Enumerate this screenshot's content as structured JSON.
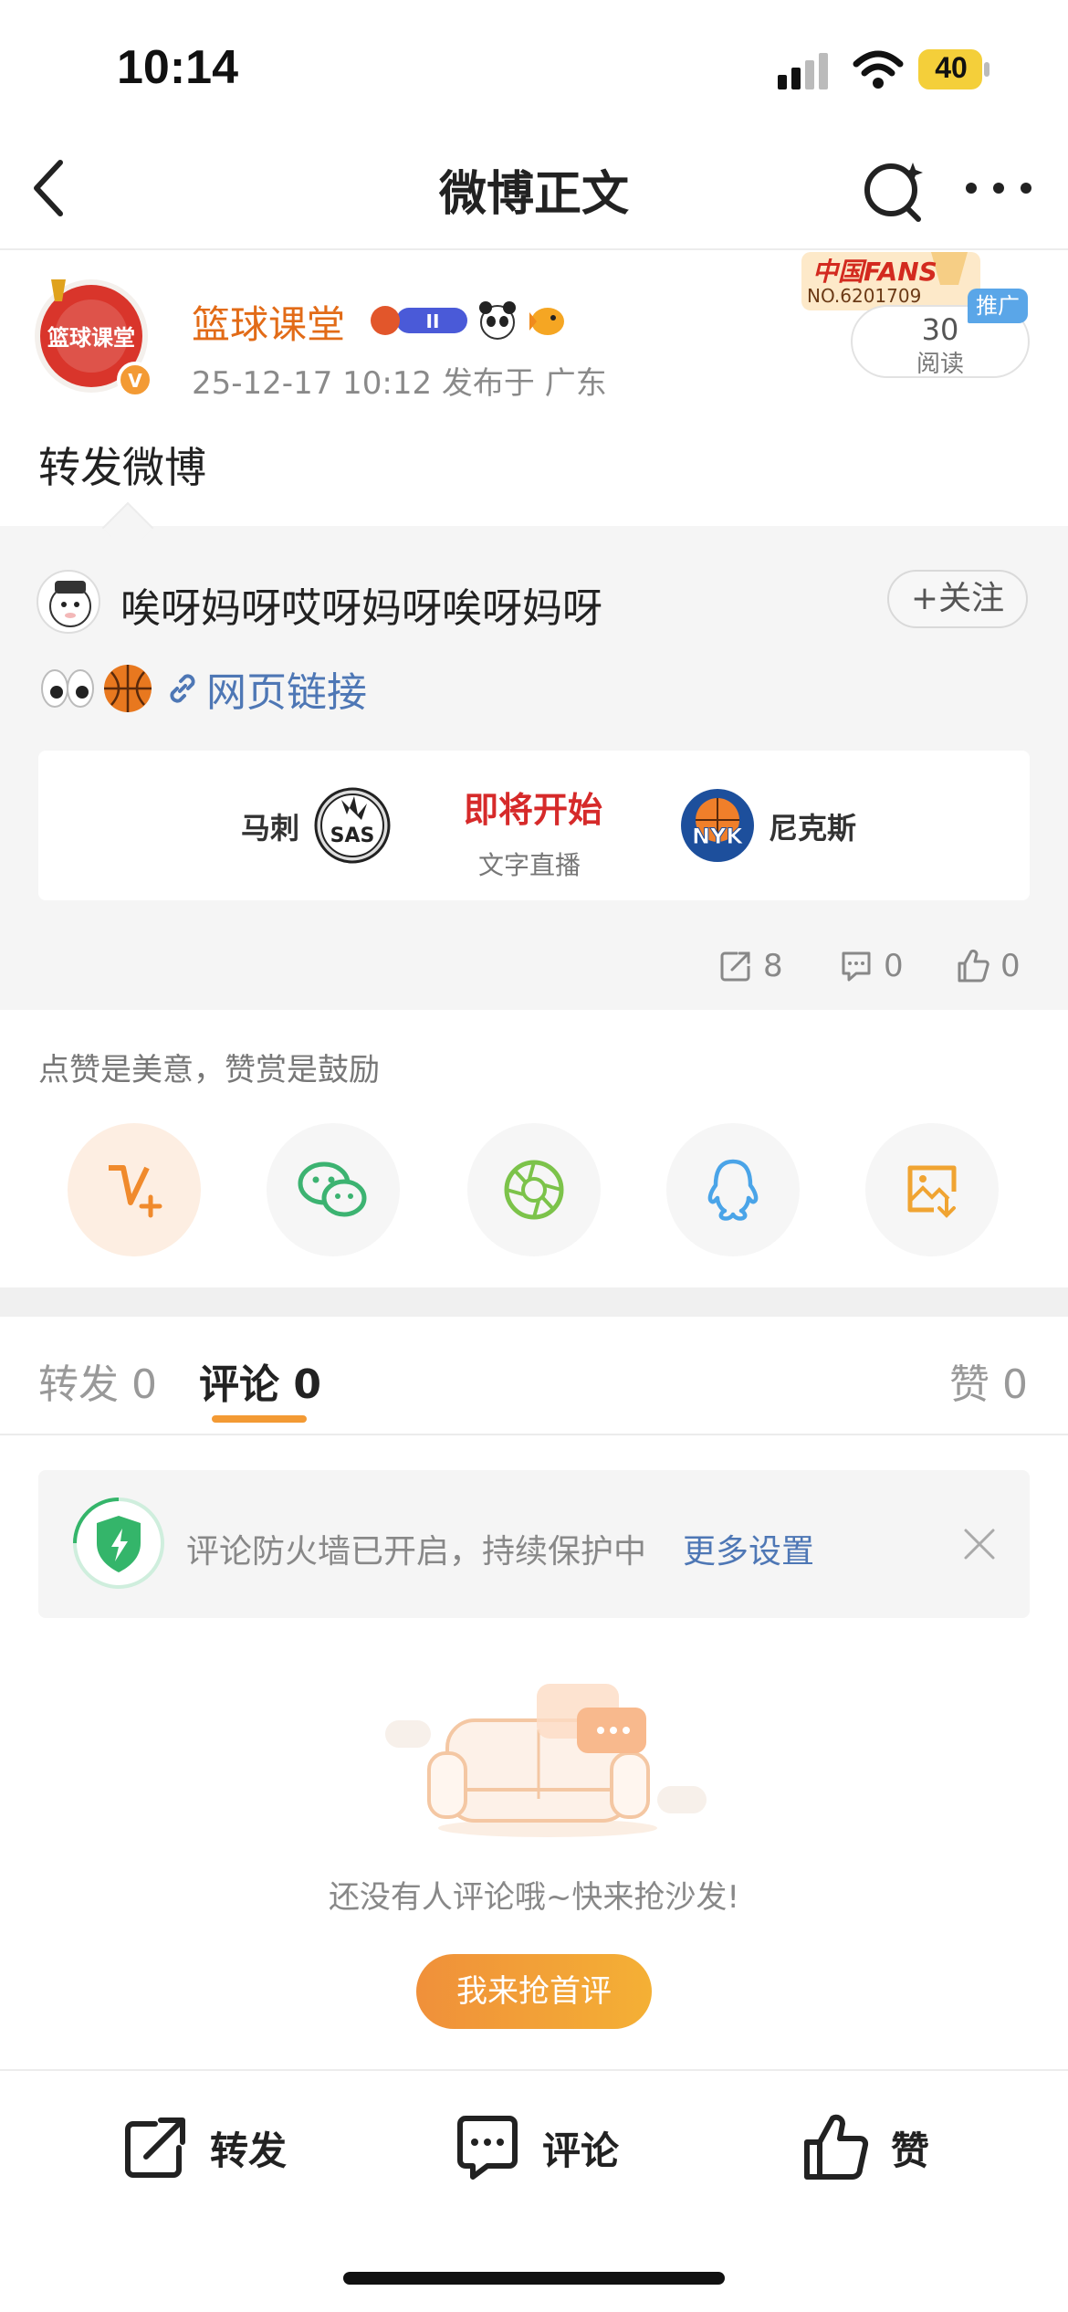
{
  "status_bar": {
    "time": "10:14",
    "battery": "40"
  },
  "nav": {
    "title": "微博正文"
  },
  "author": {
    "name": "篮球课堂",
    "meta": "25-12-17 10:12  发布于 广东",
    "fans_badge_line1": "中国FANS",
    "fans_badge_line2": "NO.6201709",
    "read_count": "30",
    "read_label": "阅读",
    "promo_tag": "推广"
  },
  "post": {
    "text": "转发微博"
  },
  "retweet": {
    "user_name": "唉呀妈呀哎呀妈呀唉呀妈呀",
    "follow_label": "+关注",
    "link_text": "网页链接",
    "match": {
      "team_left": "马刺",
      "team_left_logo": "SAS",
      "status": "即将开始",
      "sub": "文字直播",
      "team_right": "尼克斯",
      "team_right_logo": "NYK"
    },
    "stats": {
      "reposts": "8",
      "comments": "0",
      "likes": "0"
    }
  },
  "reward": {
    "text": "点赞是美意，赞赏是鼓励",
    "share_icons": [
      "vplus-icon",
      "wechat-icon",
      "moments-icon",
      "qq-icon",
      "save-image-icon"
    ]
  },
  "tabs": [
    {
      "label": "转发",
      "count": "0"
    },
    {
      "label": "评论",
      "count": "0"
    },
    {
      "label": "赞",
      "count": "0"
    }
  ],
  "firewall": {
    "text": "评论防火墙已开启，持续保护中",
    "link": "更多设置"
  },
  "empty": {
    "text": "还没有人评论哦~快来抢沙发!",
    "button": "我来抢首评"
  },
  "bottom_bar": {
    "repost": "转发",
    "comment": "评论",
    "like": "赞"
  },
  "colors": {
    "accent_orange": "#f39a34",
    "link_blue": "#4e77b5",
    "author_orange": "#e26b17",
    "live_red": "#d62a2a"
  }
}
